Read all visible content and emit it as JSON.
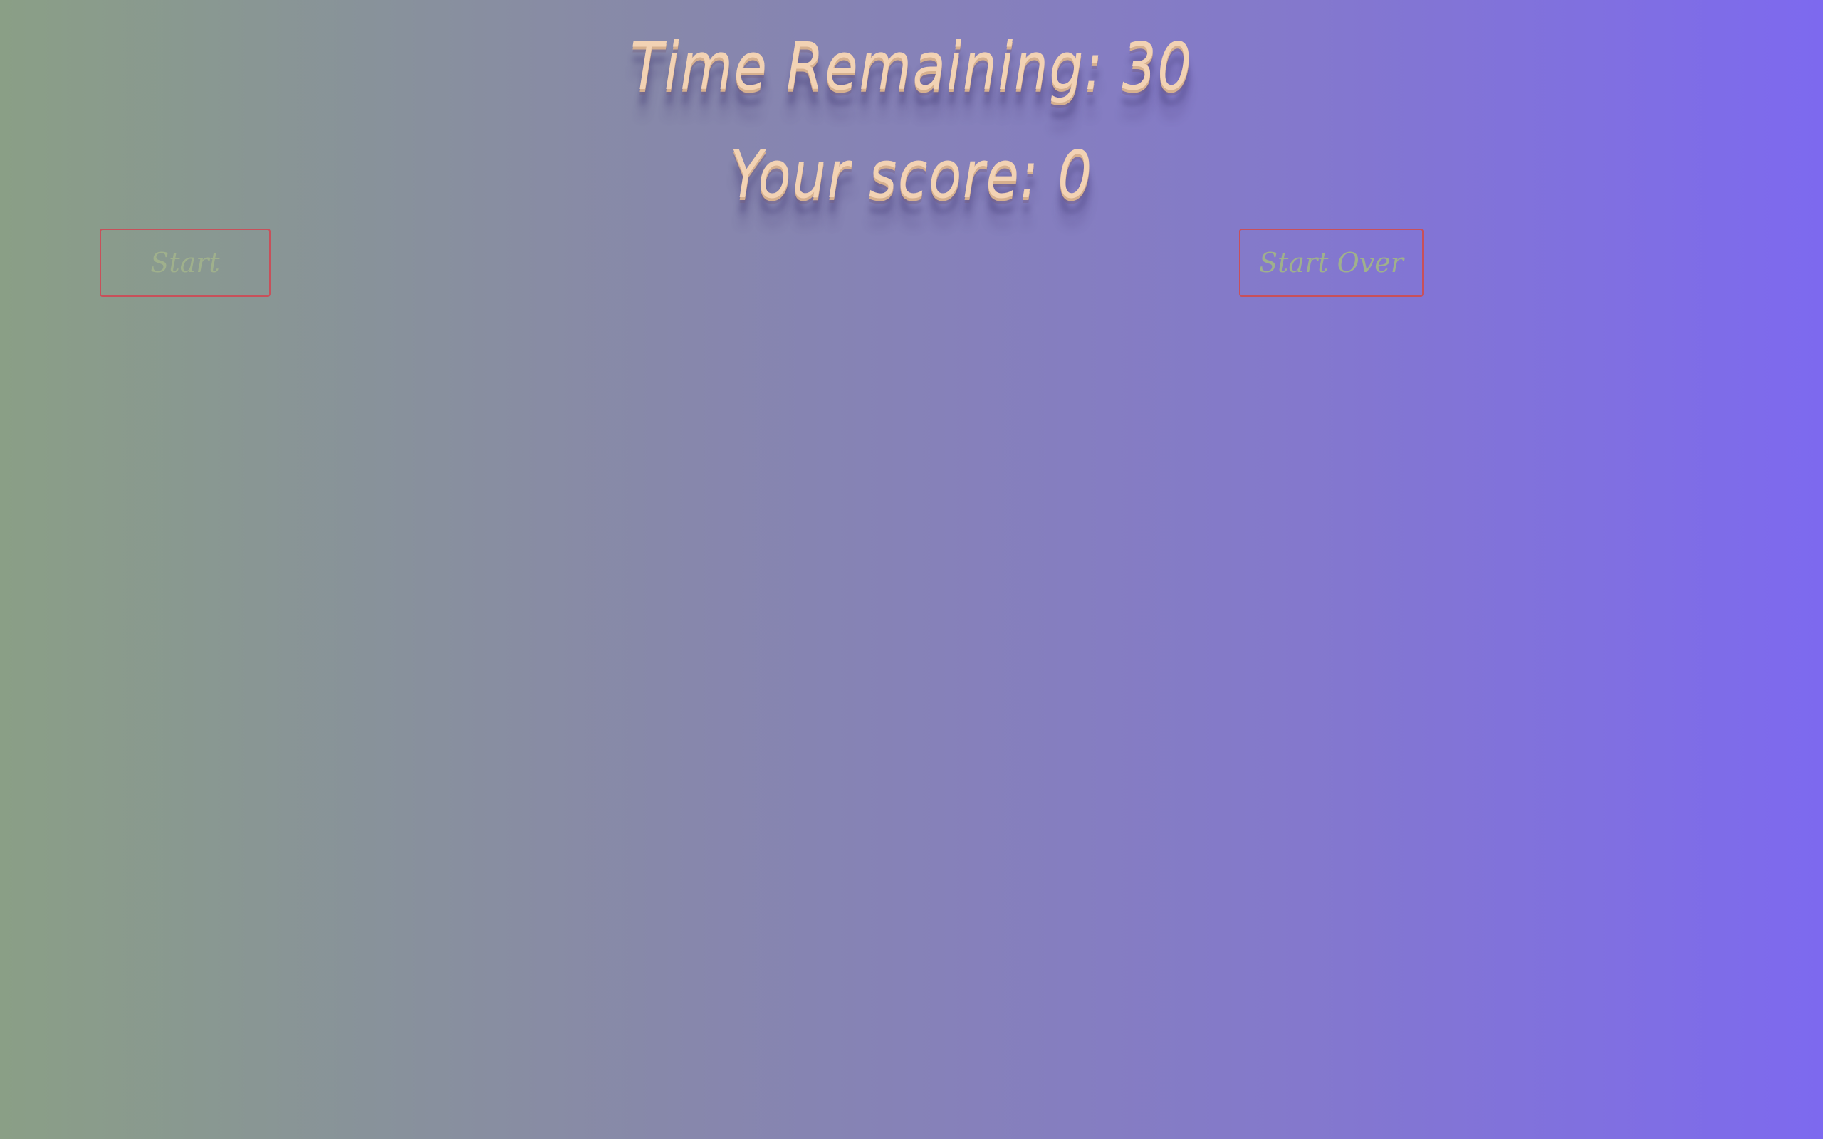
{
  "hud": {
    "time_label": "Time Remaining:",
    "time_value": "30",
    "score_label": "Your score:",
    "score_value": "0"
  },
  "controls": {
    "start_label": "Start",
    "start_over_label": "Start Over"
  },
  "colors": {
    "background_left": "#8a9f86",
    "background_right": "#7d69ef",
    "hud_text": "#f2d2b4",
    "button_border": "#c8505a",
    "button_text": "#9fb08c"
  }
}
